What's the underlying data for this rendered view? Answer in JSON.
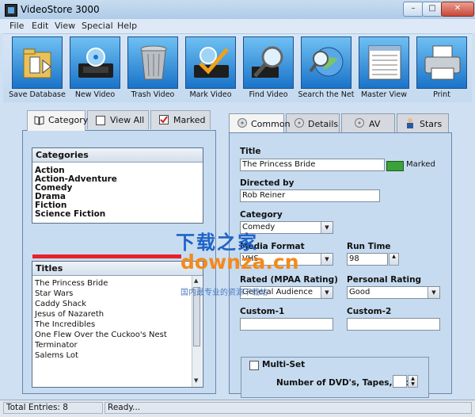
{
  "window": {
    "title": "VideoStore 3000",
    "close_glyph": "✕",
    "min_glyph": "–",
    "max_glyph": "□"
  },
  "menu": [
    "File",
    "Edit",
    "View",
    "Special",
    "Help"
  ],
  "toolbar": [
    {
      "label": "Save Database",
      "icon": "folder-database-icon"
    },
    {
      "label": "New Video",
      "icon": "video-tape-icon"
    },
    {
      "label": "Trash Video",
      "icon": "trash-can-icon"
    },
    {
      "label": "Mark Video",
      "icon": "checkmark-tape-icon"
    },
    {
      "label": "Find Video",
      "icon": "magnifier-icon"
    },
    {
      "label": "Search the Net",
      "icon": "globe-search-icon"
    },
    {
      "label": "Master View",
      "icon": "list-view-icon"
    },
    {
      "label": "Print",
      "icon": "printer-icon"
    }
  ],
  "left_tabs": {
    "category": "Category",
    "view_all": "View All",
    "marked": "Marked"
  },
  "categories": {
    "header": "Categories",
    "items": [
      "Action",
      "Action-Adventure",
      "Comedy",
      "Drama",
      "Fiction",
      "Science Fiction"
    ]
  },
  "titles": {
    "header": "Titles",
    "items": [
      "The Princess Bride",
      "Star Wars",
      "Caddy Shack",
      "Jesus of Nazareth",
      "The Incredibles",
      "One Flew Over the Cuckoo's Nest",
      "Terminator",
      "Salems Lot"
    ]
  },
  "right_tabs": {
    "common": "Common",
    "details": "Details",
    "av": "AV",
    "stars": "Stars"
  },
  "form": {
    "title_label": "Title",
    "title_value": "The Princess Bride",
    "marked_label": "Marked",
    "directed_label": "Directed by",
    "directed_value": "Rob Reiner",
    "category_label": "Category",
    "category_value": "Comedy",
    "media_label": "Media Format",
    "media_value": "VHS",
    "runtime_label": "Run Time",
    "runtime_value": "98",
    "rated_label": "Rated (MPAA Rating)",
    "rated_value": "General Audience",
    "personal_label": "Personal Rating",
    "personal_value": "Good",
    "custom1_label": "Custom-1",
    "custom1_value": "",
    "custom2_label": "Custom-2",
    "custom2_value": "",
    "multiset_label": "Multi-Set",
    "num_dvds_label": "Number of DVD's, Tapes, etc.",
    "num_dvds_value": ""
  },
  "status": {
    "entries": "Total Entries: 8",
    "ready": "Ready..."
  },
  "watermark": {
    "cn": "下载之家",
    "en": "downza.cn",
    "sub": "国内最专业的资源下载站"
  },
  "colors": {
    "accent_tile": "#1a73c9",
    "marked_green": "#3aa23a",
    "red_splitter": "#e8222a"
  }
}
